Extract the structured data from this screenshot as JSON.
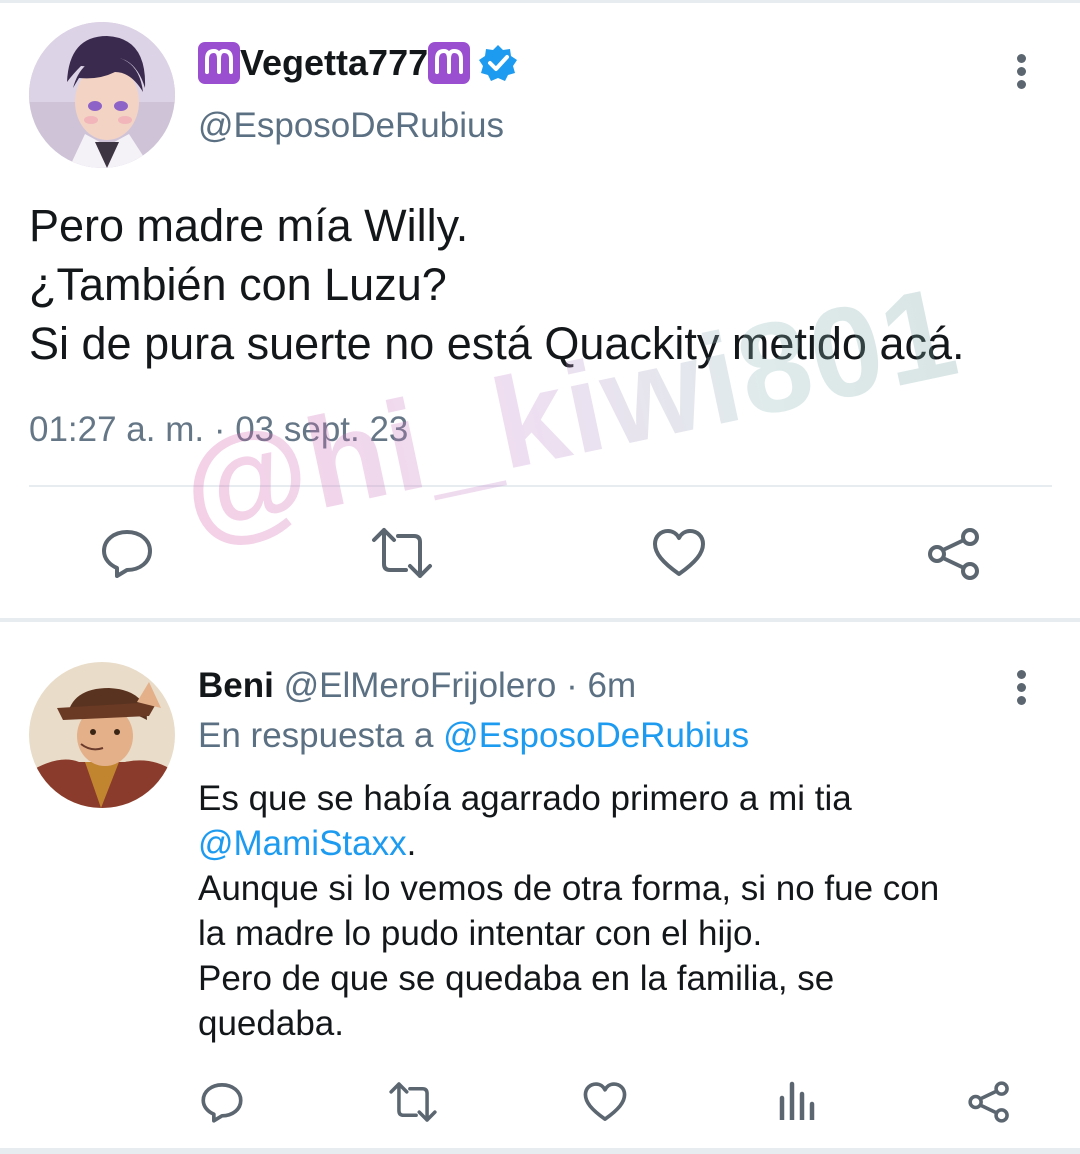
{
  "colors": {
    "accent": "#1d9bf0",
    "secondary_text": "#5b7083",
    "zodiac_bg": "#9a4fd0"
  },
  "tweet": {
    "avatar": "avatar-purple-hair-character",
    "display_name": "Vegetta777",
    "name_emoji": "aries-emoji",
    "verified": "verified-badge-icon",
    "handle": "@EsposoDeRubius",
    "body_lines": [
      "Pero madre mía Willy.",
      "¿También con Luzu?",
      "Si de pura suerte no está Quackity metido acá."
    ],
    "timestamp": "01:27 a. m. · 03 sept. 23",
    "actions": [
      "reply-icon",
      "retweet-icon",
      "like-icon",
      "share-icon"
    ]
  },
  "reply": {
    "avatar": "avatar-hat-character",
    "display_name": "Beni",
    "handle": "@ElMeroFrijolero",
    "time_ago": "· 6m",
    "in_reply_prefix": "En respuesta a",
    "in_reply_handle": "@EsposoDeRubius",
    "body_line1": "Es que se había agarrado primero a mi tia",
    "mention": "@MamiStaxx",
    "mention_suffix": ".",
    "body_rest": [
      "Aunque si lo vemos de otra forma, si no fue con",
      "la madre lo pudo intentar con el hijo.",
      "Pero de que se quedaba en la familia, se",
      "quedaba."
    ],
    "actions": [
      "reply-icon",
      "retweet-icon",
      "like-icon",
      "analytics-icon",
      "share-icon"
    ]
  },
  "watermark": "@hi_kiwi801"
}
